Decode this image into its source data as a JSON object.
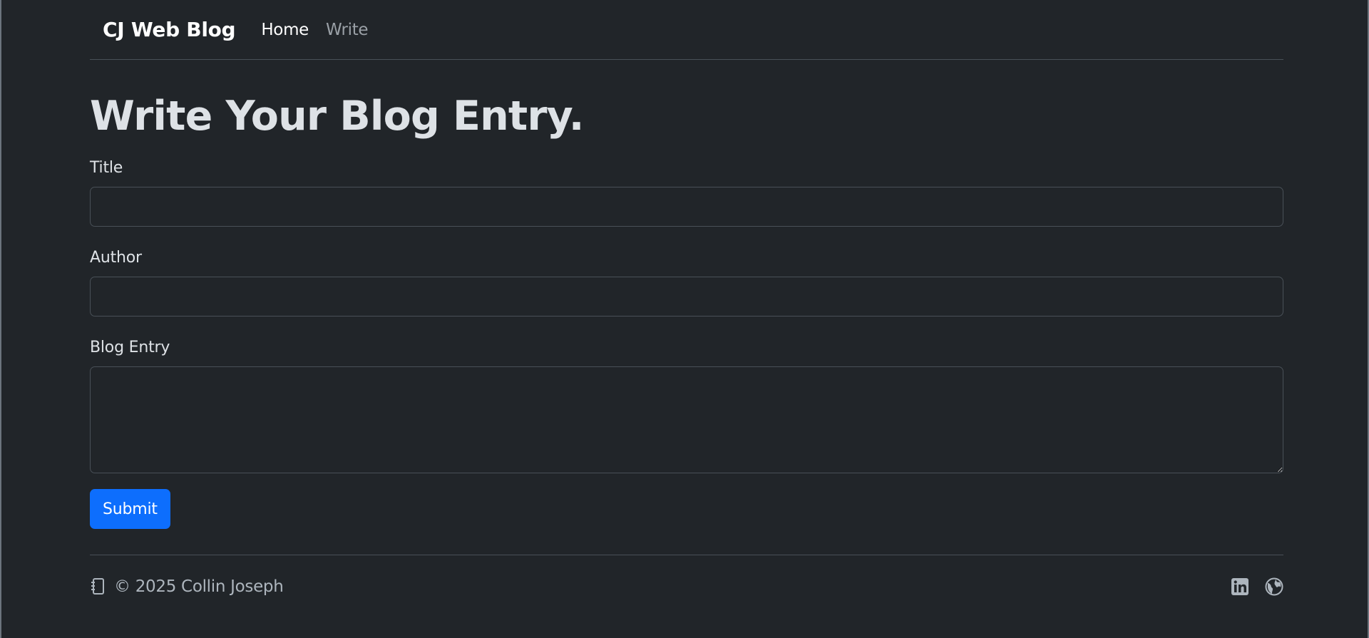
{
  "header": {
    "brand": "CJ Web Blog",
    "nav": [
      {
        "label": "Home",
        "active": true
      },
      {
        "label": "Write",
        "active": false
      }
    ]
  },
  "main": {
    "title": "Write Your Blog Entry.",
    "form": {
      "title_label": "Title",
      "title_value": "",
      "author_label": "Author",
      "author_value": "",
      "entry_label": "Blog Entry",
      "entry_value": "",
      "submit_label": "Submit"
    }
  },
  "footer": {
    "copyright": "© 2025 Collin Joseph",
    "icons": [
      "journal-icon",
      "linkedin-icon",
      "globe-icon"
    ]
  },
  "colors": {
    "background": "#212529",
    "accent": "#0d6efd",
    "text": "#dee2e6",
    "muted": "#adb5bd",
    "border": "#495057"
  }
}
